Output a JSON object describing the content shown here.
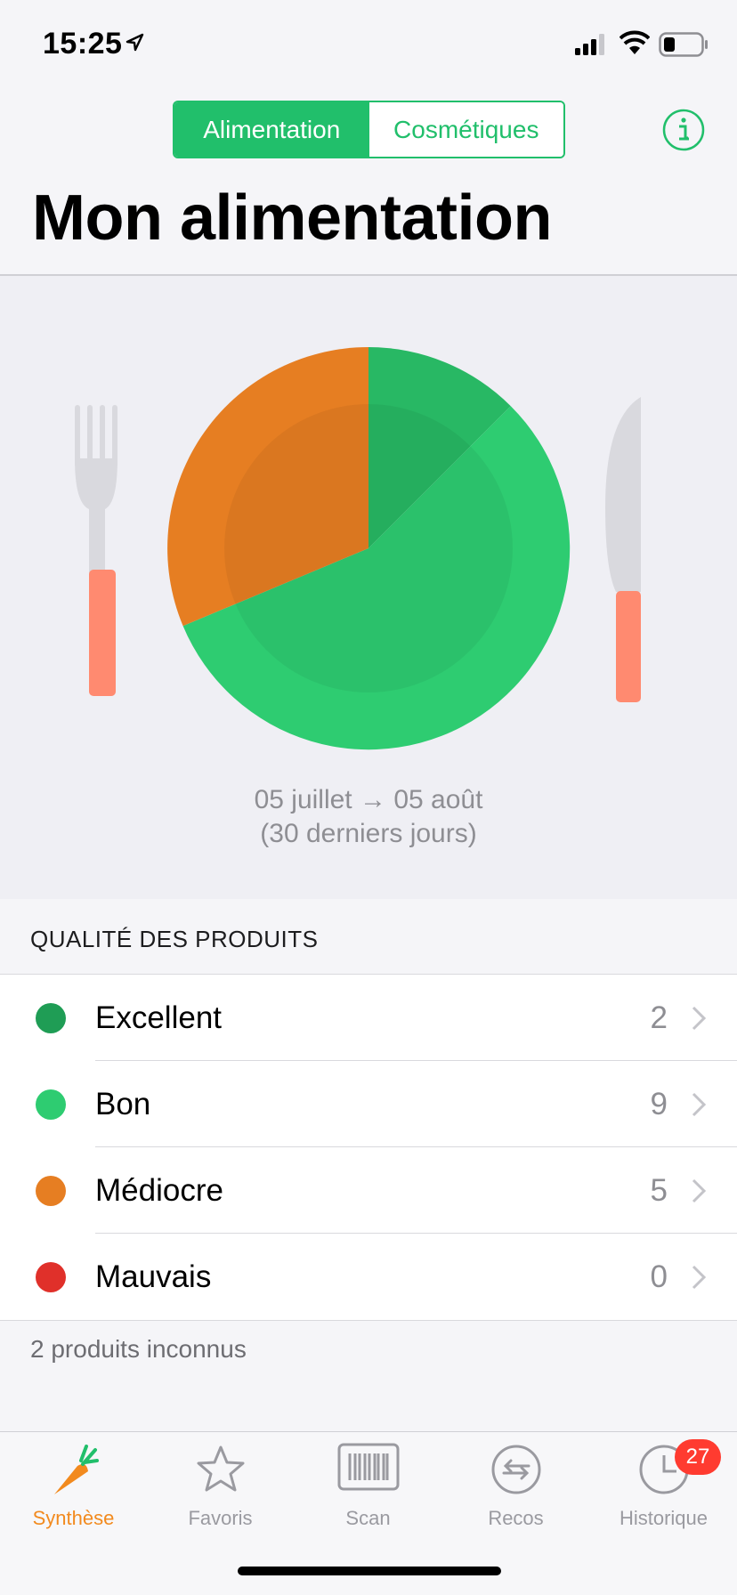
{
  "status_bar": {
    "time": "15:25"
  },
  "segmented_control": {
    "options": [
      "Alimentation",
      "Cosmétiques"
    ],
    "selected": "Alimentation"
  },
  "header": {
    "title": "Mon alimentation"
  },
  "plate": {
    "date_range": "05 juillet → 05 août",
    "period": "(30 derniers jours)"
  },
  "section": {
    "title": "QUALITÉ DES PRODUITS"
  },
  "quality": [
    {
      "label": "Excellent",
      "count": "2",
      "color": "#1f9d55"
    },
    {
      "label": "Bon",
      "count": "9",
      "color": "#2ecc71"
    },
    {
      "label": "Médiocre",
      "count": "5",
      "color": "#e67e22"
    },
    {
      "label": "Mauvais",
      "count": "0",
      "color": "#e0302a"
    }
  ],
  "unknown_products": "2 produits inconnus",
  "tabs": [
    {
      "label": "Synthèse",
      "icon": "carrot-icon",
      "active": true
    },
    {
      "label": "Favoris",
      "icon": "star-icon"
    },
    {
      "label": "Scan",
      "icon": "barcode-icon"
    },
    {
      "label": "Recos",
      "icon": "recommendations-icon"
    },
    {
      "label": "Historique",
      "icon": "clock-icon",
      "badge": "27"
    }
  ],
  "colors": {
    "accent": "#21bf6b",
    "active_tab": "#f28a1e",
    "badge": "#ff3b30"
  }
}
